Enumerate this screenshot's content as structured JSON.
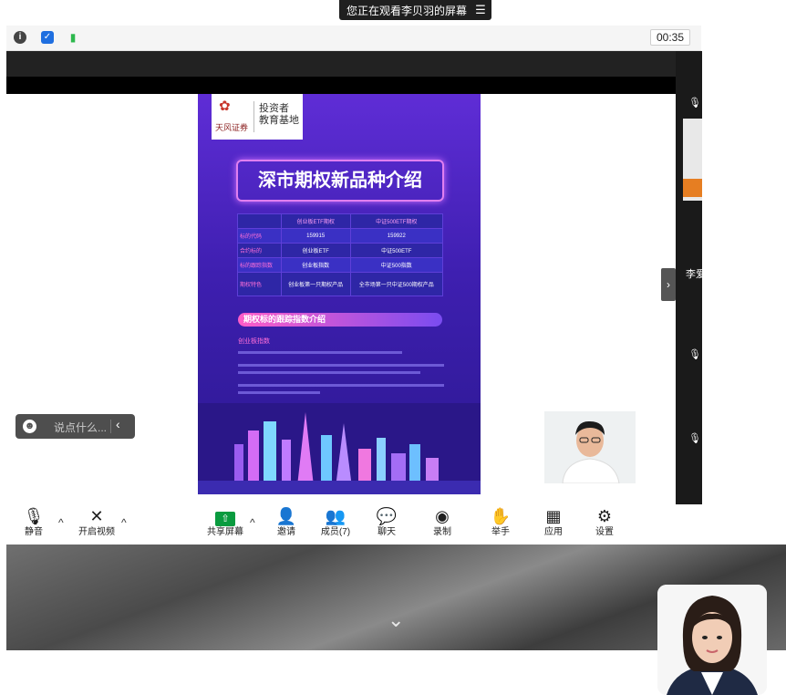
{
  "banner": {
    "text": "您正在观看李贝羽的屏幕",
    "menu_icon": "list-icon"
  },
  "titlebar": {
    "icons": [
      "info-icon",
      "shield-icon",
      "signal-icon"
    ],
    "icon_colors": {
      "info": "#444444",
      "shield": "#1f6fe0",
      "signal": "#2db84d"
    },
    "timer": "00:35"
  },
  "slide": {
    "logo_text": "天风证券",
    "logo_tag": "投资者\n教育基地",
    "title": "深市期权新品种介绍",
    "table": {
      "headers": [
        "",
        "创业板ETF期权",
        "中证500ETF期权"
      ],
      "rows": [
        [
          "标的代码",
          "159915",
          "159922"
        ],
        [
          "合约标的",
          "创业板ETF",
          "中证500ETF"
        ],
        [
          "标的跟踪指数",
          "创业板指数",
          "中证500指数"
        ],
        [
          "期权特色",
          "创业板第一只期权产品",
          "全市场第一只中证500期权产品"
        ]
      ]
    },
    "section_title": "期权标的跟踪指数介绍",
    "sub_title": "创业板指数"
  },
  "chat": {
    "placeholder": "说点什么...",
    "collapse_icon": "chevron-left-icon",
    "emoji_icon": "emoji-icon"
  },
  "strip": {
    "partial_name": "李爱"
  },
  "toolbar": {
    "items": [
      {
        "label": "静音",
        "icon": "microphone-icon"
      },
      {
        "label": "开启视频",
        "icon": "video-off-icon"
      },
      {
        "label": "共享屏幕",
        "icon": "share-screen-icon"
      },
      {
        "label": "邀请",
        "icon": "invite-icon"
      },
      {
        "label": "成员(7)",
        "icon": "members-icon"
      },
      {
        "label": "聊天",
        "icon": "chat-icon"
      },
      {
        "label": "录制",
        "icon": "record-icon"
      },
      {
        "label": "举手",
        "icon": "raise-hand-icon"
      },
      {
        "label": "应用",
        "icon": "apps-icon"
      },
      {
        "label": "设置",
        "icon": "settings-icon"
      }
    ],
    "accent": "#0a9b3f"
  },
  "bottom": {
    "chevron": "chevron-down-icon"
  }
}
